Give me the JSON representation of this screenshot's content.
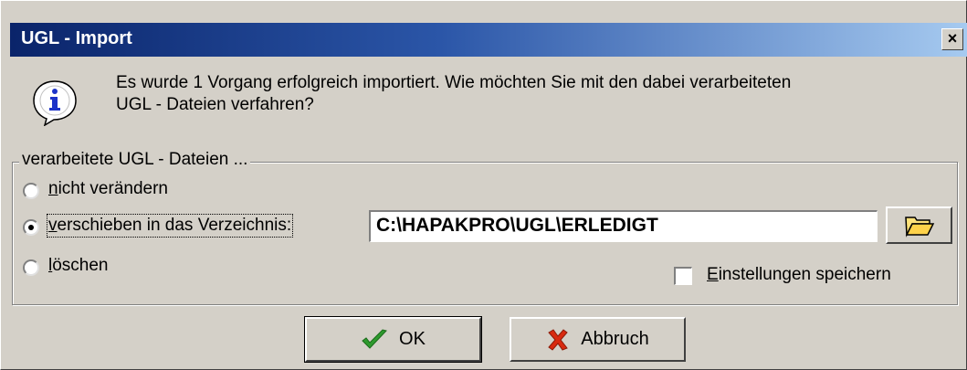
{
  "window": {
    "title": "UGL - Import",
    "close_label": "×"
  },
  "message": {
    "line1": "Es wurde 1 Vorgang erfolgreich importiert. Wie möchten Sie mit den dabei verarbeiteten",
    "line2": "UGL - Dateien verfahren?",
    "icon": "info-icon"
  },
  "group": {
    "legend": "verarbeitete UGL - Dateien ...",
    "options": [
      {
        "accel": "n",
        "rest": "icht verändern",
        "checked": false
      },
      {
        "accel": "v",
        "rest": "erschieben in das Verzeichnis:",
        "checked": true
      },
      {
        "accel": "l",
        "rest": "öschen",
        "checked": false
      }
    ],
    "path_value": "C:\\HAPAKPRO\\UGL\\ERLEDIGT",
    "browse_icon": "folder-open-icon",
    "save_settings": {
      "accel": "E",
      "rest": "instellungen speichern",
      "checked": false
    }
  },
  "buttons": {
    "ok": {
      "label": "OK",
      "icon": "checkmark-icon",
      "icon_color": "#2e9a2e"
    },
    "cancel": {
      "label": "Abbruch",
      "icon": "x-icon",
      "icon_color": "#d82a10"
    }
  },
  "colors": {
    "titlebar_start": "#0a246a",
    "titlebar_end": "#a6caf0",
    "face": "#d4d0c8"
  }
}
